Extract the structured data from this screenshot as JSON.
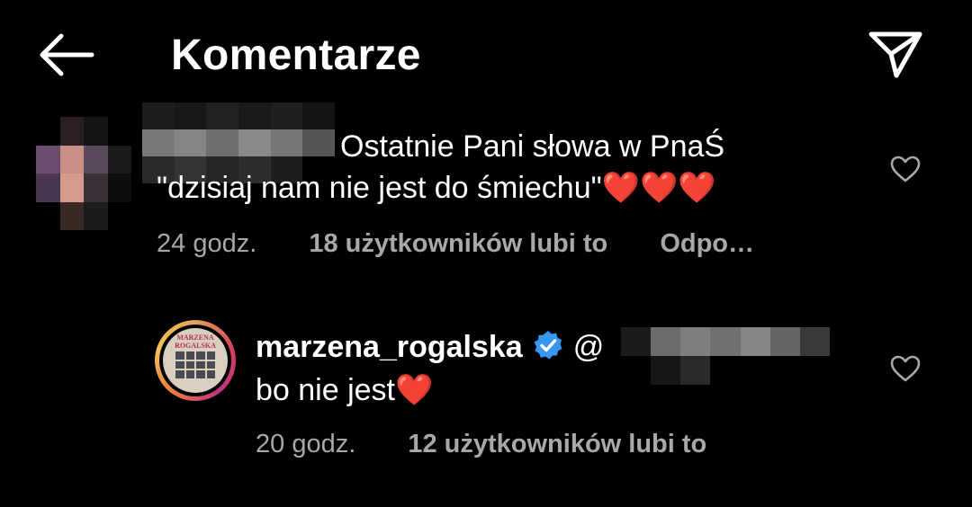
{
  "header": {
    "title": "Komentarze",
    "back_icon": "arrow-left-icon",
    "send_icon": "paper-plane-icon"
  },
  "comment": {
    "text_line1": "Ostatnie Pani słowa w PnaŚ",
    "text_line2": "\"dzisiaj nam nie jest do śmiechu\"❤️❤️❤️",
    "time": "24 godz.",
    "likes": "18 użytkowników lubi to",
    "reply": "Odpo…"
  },
  "reply": {
    "username": "marzena_rogalska",
    "mention_prefix": "@",
    "text": "bo nie jest❤️",
    "time": "20 godz.",
    "likes": "12 użytkowników lubi to",
    "avatar_text_line1": "MARZENA",
    "avatar_text_line2": "ROGALSKA"
  },
  "colors": {
    "background": "#000000",
    "text": "#ffffff",
    "meta": "#a8a8a8",
    "verified": "#3897f0"
  }
}
